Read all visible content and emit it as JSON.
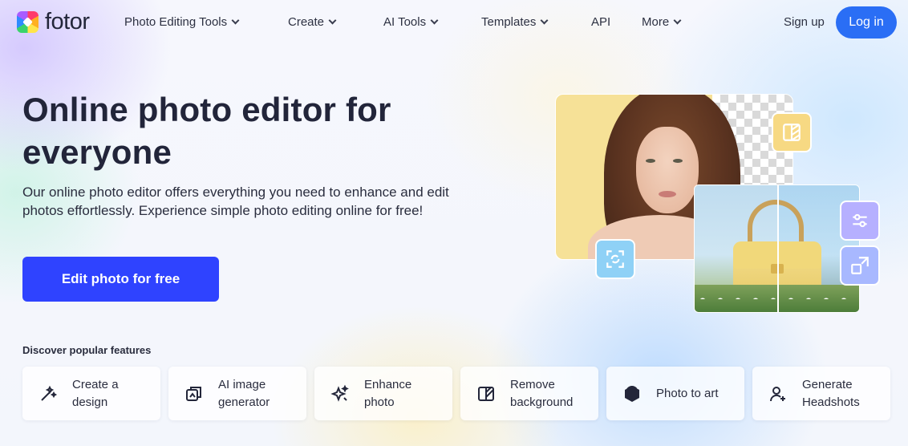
{
  "brand": {
    "name": "fotor"
  },
  "nav": {
    "items": [
      {
        "label": "Photo Editing Tools",
        "dropdown": true
      },
      {
        "label": "Create",
        "dropdown": true
      },
      {
        "label": "AI Tools",
        "dropdown": true
      },
      {
        "label": "Templates",
        "dropdown": true
      },
      {
        "label": "API",
        "dropdown": false
      },
      {
        "label": "More",
        "dropdown": true
      }
    ],
    "signup": "Sign up",
    "login": "Log in"
  },
  "hero": {
    "title": "Online photo editor for everyone",
    "subtitle": "Our online photo editor offers everything you need to enhance and edit photos effortlessly. Experience simple photo editing online for free!",
    "cta": "Edit photo for free"
  },
  "features": {
    "heading": "Discover popular features",
    "items": [
      {
        "label": "Create a design",
        "icon": "magic-wand-icon"
      },
      {
        "label": "AI image generator",
        "icon": "ai-image-icon"
      },
      {
        "label": "Enhance photo",
        "icon": "sparkle-enhance-icon"
      },
      {
        "label": "Remove background",
        "icon": "remove-bg-icon"
      },
      {
        "label": "Photo to art",
        "icon": "art-g-icon"
      },
      {
        "label": "Generate Headshots",
        "icon": "user-plus-icon"
      }
    ]
  },
  "colors": {
    "primary_cta": "#2f43ff",
    "login_button": "#2a6ef5",
    "text_dark": "#22253a"
  }
}
